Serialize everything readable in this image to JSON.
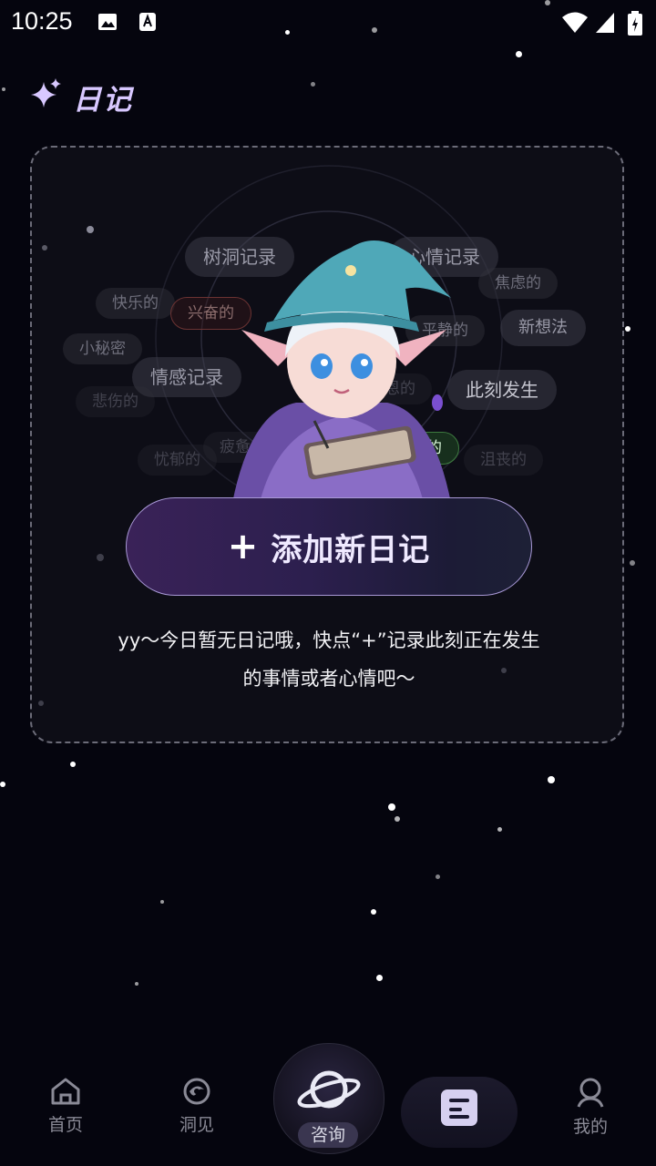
{
  "status_bar": {
    "time": "10:25"
  },
  "header": {
    "title": "日记"
  },
  "card": {
    "tags": [
      "树洞记录",
      "心情记录",
      "焦虑的",
      "快乐的",
      "兴奋的",
      "平静的",
      "新想法",
      "小秘密",
      "情感记录",
      "感恩的",
      "此刻发生",
      "悲伤的",
      "忧郁的",
      "自信的",
      "沮丧的",
      "疲惫的"
    ],
    "add_button_label": "添加新日记",
    "empty_line1": "yy～今日暂无日记哦，快点“+”记录此刻正在发生",
    "empty_line2": "的事情或者心情吧～"
  },
  "nav": {
    "items": [
      {
        "label": "首页",
        "icon": "home-icon"
      },
      {
        "label": "洞见",
        "icon": "swirl-icon"
      },
      {
        "label": "咨询",
        "icon": "planet-icon"
      },
      {
        "label": "",
        "icon": "diary-icon"
      },
      {
        "label": "我的",
        "icon": "profile-icon"
      }
    ]
  },
  "colors": {
    "accent": "#d8c8ff",
    "background": "#05050e",
    "button_border": "#a898d6"
  }
}
